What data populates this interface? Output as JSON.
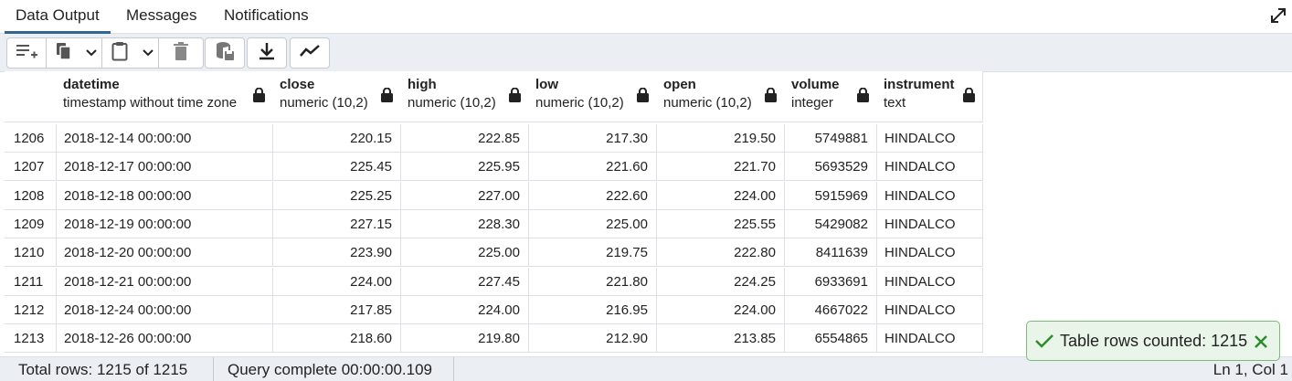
{
  "tabs": [
    {
      "label": "Data Output",
      "active": true
    },
    {
      "label": "Messages",
      "active": false
    },
    {
      "label": "Notifications",
      "active": false
    }
  ],
  "columns": [
    {
      "name": "datetime",
      "type": "timestamp without time zone"
    },
    {
      "name": "close",
      "type": "numeric (10,2)"
    },
    {
      "name": "high",
      "type": "numeric (10,2)"
    },
    {
      "name": "low",
      "type": "numeric (10,2)"
    },
    {
      "name": "open",
      "type": "numeric (10,2)"
    },
    {
      "name": "volume",
      "type": "integer"
    },
    {
      "name": "instrument",
      "type": "text"
    }
  ],
  "rows": [
    {
      "n": "1206",
      "cells": [
        "2018-12-14 00:00:00",
        "220.15",
        "222.85",
        "217.30",
        "219.50",
        "5749881",
        "HINDALCO"
      ]
    },
    {
      "n": "1207",
      "cells": [
        "2018-12-17 00:00:00",
        "225.45",
        "225.95",
        "221.60",
        "221.70",
        "5693529",
        "HINDALCO"
      ]
    },
    {
      "n": "1208",
      "cells": [
        "2018-12-18 00:00:00",
        "225.25",
        "227.00",
        "222.60",
        "224.00",
        "5915969",
        "HINDALCO"
      ]
    },
    {
      "n": "1209",
      "cells": [
        "2018-12-19 00:00:00",
        "227.15",
        "228.30",
        "225.00",
        "225.55",
        "5429082",
        "HINDALCO"
      ]
    },
    {
      "n": "1210",
      "cells": [
        "2018-12-20 00:00:00",
        "223.90",
        "225.00",
        "219.75",
        "222.80",
        "8411639",
        "HINDALCO"
      ]
    },
    {
      "n": "1211",
      "cells": [
        "2018-12-21 00:00:00",
        "224.00",
        "227.45",
        "221.80",
        "224.25",
        "6933691",
        "HINDALCO"
      ]
    },
    {
      "n": "1212",
      "cells": [
        "2018-12-24 00:00:00",
        "217.85",
        "224.00",
        "216.95",
        "224.00",
        "4667022",
        "HINDALCO"
      ]
    },
    {
      "n": "1213",
      "cells": [
        "2018-12-26 00:00:00",
        "218.60",
        "219.80",
        "212.90",
        "213.85",
        "6554865",
        "HINDALCO"
      ]
    }
  ],
  "status": {
    "total_rows": "Total rows: 1215 of 1215",
    "query": "Query complete 00:00:00.109",
    "cursor": "Ln 1, Col 1"
  },
  "toast": {
    "message": "Table rows counted: 1215"
  },
  "icons": [
    "expand-icon",
    "add-row-icon",
    "copy-icon",
    "chevron-down-icon",
    "paste-icon",
    "delete-icon",
    "save-data-icon",
    "download-icon",
    "graph-icon",
    "lock-icon",
    "check-icon",
    "close-icon"
  ],
  "colors": {
    "accent": "#326690",
    "toolbar_bg": "#ebeef3",
    "toast_bg": "#eaf5e9",
    "toast_border": "#7dbb7a",
    "success": "#2e8b2e"
  }
}
